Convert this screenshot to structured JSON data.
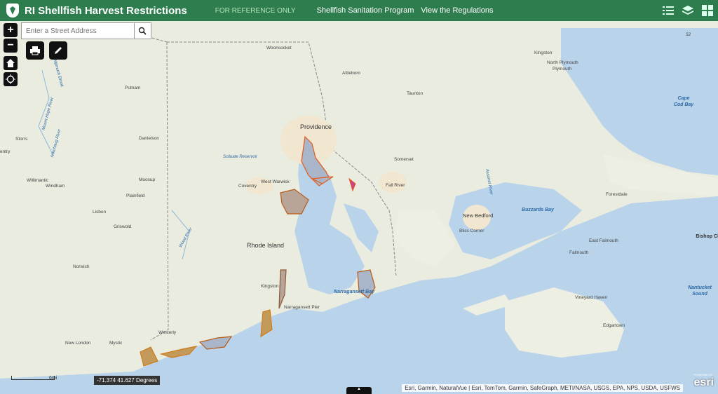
{
  "header": {
    "title": "RI Shellfish Harvest Restrictions",
    "reference": "FOR REFERENCE ONLY",
    "link1": "Shellfish Sanitation Program",
    "link2": "View the Regulations",
    "icons": [
      "legend-list-icon",
      "layers-icon",
      "apps-grid-icon"
    ]
  },
  "search": {
    "placeholder": "Enter a Street Address"
  },
  "controls": {
    "zoom_in": "+",
    "zoom_out": "−"
  },
  "map": {
    "places": [
      "Woonsocket",
      "Attleboro",
      "Kingston",
      "North Plymouth",
      "Plymouth",
      "Taunton",
      "Putnam",
      "Providence",
      "Storrs",
      "Danielson",
      "Somerset",
      "Scituate Reservoir",
      "Willimantic",
      "Windham",
      "Moosup",
      "Plainfield",
      "Coventry",
      "West Warwick",
      "Fall River",
      "Forestdale",
      "Rhode Island",
      "New Bedford",
      "Bliss Corner",
      "East Falmouth",
      "Falmouth",
      "Griswold",
      "Lisbon",
      "Norwich",
      "Kingston",
      "Narragansett Pier",
      "Westerly",
      "New London",
      "Mystic",
      "Vineyard Haven",
      "Edgartown",
      "entry"
    ],
    "water": [
      "Cape Cod Bay",
      "Buzzards Bay",
      "Narragansett Bay",
      "Nantucket Sound",
      "Bishop Cler"
    ],
    "rivers": [
      "Mount Hope River",
      "Natchaug River",
      "Nipmuck Brook",
      "Wood River",
      "Assonet River"
    ],
    "route_marker": "52"
  },
  "coordinates": "-71.374 41.627 Degrees",
  "scale_label": "6mi",
  "attribution": "Esri, Garmin, NaturalVue | Esri, TomTom, Garmin, SafeGraph, METI/NASA, USGS, EPA, NPS, USDA, USFWS",
  "esri": {
    "powered": "POWERED BY",
    "name": "esri"
  }
}
